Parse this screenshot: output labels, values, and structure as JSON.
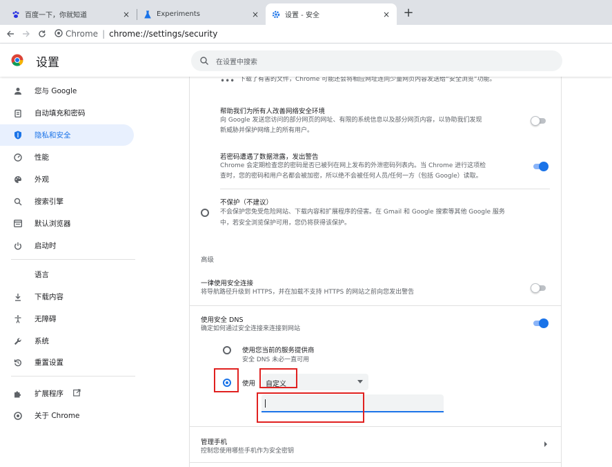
{
  "browser": {
    "tabs": [
      {
        "title": "百度一下，你就知道",
        "icon": "baidu-paw-icon",
        "active": false
      },
      {
        "title": "Experiments",
        "icon": "flask-icon",
        "active": false
      },
      {
        "title": "设置 - 安全",
        "icon": "gear-icon",
        "active": true
      }
    ],
    "tab_close": "×",
    "new_tab": "+",
    "site_label": "Chrome",
    "url_separator": "|",
    "url": "chrome://settings/security"
  },
  "header": {
    "title": "设置",
    "search_placeholder": "在设置中搜索"
  },
  "sidebar": {
    "items": [
      {
        "label": "您与 Google",
        "icon": "person-icon"
      },
      {
        "label": "自动填充和密码",
        "icon": "clipboard-icon"
      },
      {
        "label": "隐私和安全",
        "icon": "shield-icon",
        "active": true
      },
      {
        "label": "性能",
        "icon": "speedometer-icon"
      },
      {
        "label": "外观",
        "icon": "palette-icon"
      },
      {
        "label": "搜索引擎",
        "icon": "search-icon"
      },
      {
        "label": "默认浏览器",
        "icon": "browser-window-icon"
      },
      {
        "label": "启动时",
        "icon": "power-icon"
      },
      {
        "label": "语言",
        "icon": ""
      },
      {
        "label": "下载内容",
        "icon": "download-icon"
      },
      {
        "label": "无障碍",
        "icon": "accessibility-icon"
      },
      {
        "label": "系统",
        "icon": "wrench-icon"
      },
      {
        "label": "重置设置",
        "icon": "reset-icon"
      },
      {
        "label": "扩展程序",
        "icon": "puzzle-icon"
      },
      {
        "label": "关于 Chrome",
        "icon": "chrome-icon"
      }
    ]
  },
  "main": {
    "top_fragment": "下载了有害的文件，Chrome 可能还会将相应网址连同少量网页内容发送给“安全浏览”功能。",
    "improve": {
      "title": "帮助我们为所有人改善网络安全环境",
      "desc1": "向 Google 发送您访问的部分网页的网址、有限的系统信息以及部分网页内容，以协助我们发现",
      "desc2": "新威胁并保护网络上的所有用户。",
      "enabled": false
    },
    "password_leak": {
      "title": "若密码遭遇了数据泄露，发出警告",
      "desc1": "Chrome 会定期检查您的密码是否已被列在网上发布的外泄密码列表内。当 Chrome 进行这项检",
      "desc2": "查时，您的密码和用户名都会被加密，所以绝不会被任何人员/任何一方（包括 Google）读取。",
      "enabled": true
    },
    "no_protection": {
      "title": "不保护（不建议）",
      "desc1": "不会保护您免受危险网站、下载内容和扩展程序的侵害。在 Gmail 和 Google 搜索等其他 Google 服务",
      "desc2": "中，若安全浏览保护可用，您仍将获得该保护。"
    },
    "advanced_heading": "高级",
    "https": {
      "title": "一律使用安全连接",
      "desc": "将导航路径升级到 HTTPS，并在加载不支持 HTTPS 的网站之前向您发出警告",
      "enabled": false
    },
    "dns": {
      "title": "使用安全 DNS",
      "desc": "确定如何通过安全连接来连接到网站",
      "enabled": true,
      "option_current_title": "使用您当前的服务提供商",
      "option_current_desc": "安全 DNS 未必一直可用",
      "option_custom_label": "使用",
      "selected_value": "自定义",
      "custom_input_value": "",
      "custom_selected": true
    },
    "phone": {
      "title": "管理手机",
      "desc": "控制您使用哪些手机作为安全密钥"
    }
  },
  "colors": {
    "accent": "#1a73e8",
    "highlight": "#e0201f"
  }
}
